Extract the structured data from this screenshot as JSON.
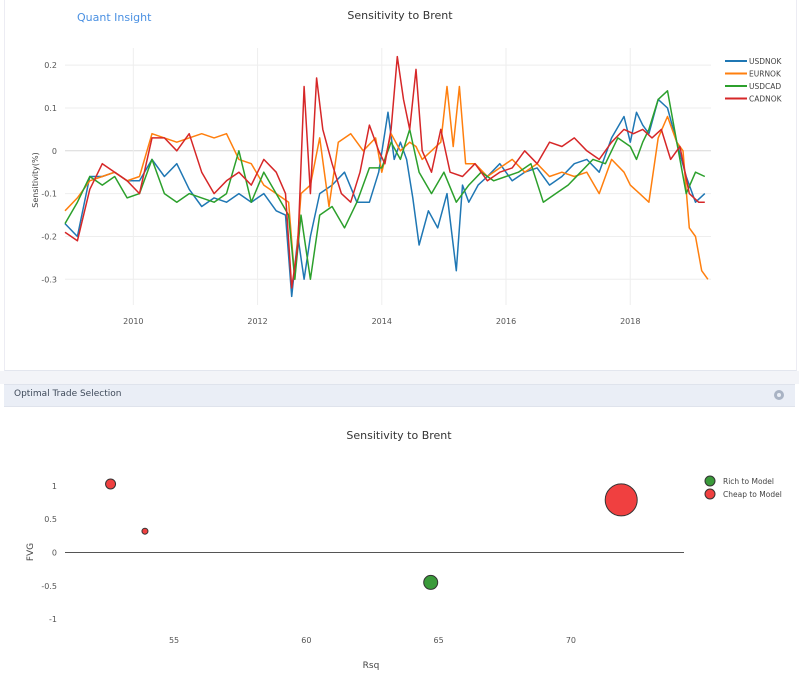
{
  "app": {
    "brand": "Quant Insight"
  },
  "panel": {
    "title": "Optimal Trade Selection"
  },
  "chart_data": [
    {
      "type": "line",
      "title": "Sensitivity to Brent",
      "xlabel": "",
      "ylabel": "Sensitivity(%)",
      "xlim": [
        2008.9,
        2019.3
      ],
      "ylim": [
        -0.36,
        0.24
      ],
      "xticks": [
        2010,
        2012,
        2014,
        2016,
        2018
      ],
      "yticks": [
        0.2,
        0.1,
        0,
        -0.1,
        -0.2,
        -0.3
      ],
      "ytick_labels": [
        "0.2",
        "0.1",
        "0",
        "-0.1",
        "-0.2",
        "-0.3"
      ],
      "grid": true,
      "legend_position": "top-right",
      "series": [
        {
          "name": "USDNOK",
          "color": "#1f77b4",
          "x": [
            2008.9,
            2009.1,
            2009.3,
            2009.5,
            2009.7,
            2009.9,
            2010.1,
            2010.3,
            2010.5,
            2010.7,
            2010.9,
            2011.1,
            2011.3,
            2011.5,
            2011.7,
            2011.9,
            2012.1,
            2012.3,
            2012.45,
            2012.55,
            2012.65,
            2012.75,
            2012.85,
            2013.0,
            2013.2,
            2013.4,
            2013.6,
            2013.8,
            2013.95,
            2014.1,
            2014.2,
            2014.3,
            2014.4,
            2014.5,
            2014.6,
            2014.75,
            2014.9,
            2015.05,
            2015.2,
            2015.3,
            2015.4,
            2015.55,
            2015.7,
            2015.9,
            2016.1,
            2016.3,
            2016.5,
            2016.7,
            2016.9,
            2017.1,
            2017.3,
            2017.5,
            2017.7,
            2017.9,
            2018.0,
            2018.1,
            2018.2,
            2018.3,
            2018.45,
            2018.6,
            2018.75,
            2018.9,
            2019.05,
            2019.2
          ],
          "y": [
            -0.17,
            -0.2,
            -0.06,
            -0.06,
            -0.05,
            -0.07,
            -0.07,
            -0.02,
            -0.06,
            -0.03,
            -0.09,
            -0.13,
            -0.11,
            -0.12,
            -0.1,
            -0.12,
            -0.1,
            -0.14,
            -0.15,
            -0.34,
            -0.2,
            -0.3,
            -0.2,
            -0.1,
            -0.08,
            -0.05,
            -0.12,
            -0.12,
            -0.05,
            0.09,
            -0.02,
            0.02,
            -0.02,
            -0.11,
            -0.22,
            -0.14,
            -0.18,
            -0.1,
            -0.28,
            -0.08,
            -0.12,
            -0.08,
            -0.06,
            -0.03,
            -0.07,
            -0.05,
            -0.04,
            -0.08,
            -0.06,
            -0.03,
            -0.02,
            -0.05,
            0.03,
            0.08,
            0.02,
            0.09,
            0.06,
            0.04,
            0.12,
            0.1,
            0.02,
            -0.06,
            -0.12,
            -0.1
          ]
        },
        {
          "name": "EURNOK",
          "color": "#ff7f0e",
          "x": [
            2008.9,
            2009.1,
            2009.3,
            2009.5,
            2009.7,
            2009.9,
            2010.1,
            2010.3,
            2010.5,
            2010.7,
            2010.9,
            2011.1,
            2011.3,
            2011.5,
            2011.7,
            2011.9,
            2012.1,
            2012.3,
            2012.5,
            2012.6,
            2012.7,
            2012.85,
            2013.0,
            2013.15,
            2013.3,
            2013.5,
            2013.7,
            2013.9,
            2014.0,
            2014.15,
            2014.3,
            2014.45,
            2014.55,
            2014.65,
            2014.8,
            2014.95,
            2015.05,
            2015.15,
            2015.25,
            2015.35,
            2015.5,
            2015.7,
            2015.9,
            2016.1,
            2016.3,
            2016.5,
            2016.7,
            2016.9,
            2017.1,
            2017.3,
            2017.5,
            2017.7,
            2017.9,
            2018.0,
            2018.15,
            2018.3,
            2018.45,
            2018.6,
            2018.75,
            2018.85,
            2018.95,
            2019.05,
            2019.15,
            2019.25
          ],
          "y": [
            -0.14,
            -0.11,
            -0.07,
            -0.06,
            -0.05,
            -0.07,
            -0.06,
            0.04,
            0.03,
            0.02,
            0.03,
            0.04,
            0.03,
            0.04,
            -0.02,
            -0.03,
            -0.08,
            -0.1,
            -0.12,
            -0.3,
            -0.1,
            -0.08,
            0.03,
            -0.13,
            0.02,
            0.04,
            0.0,
            0.03,
            -0.05,
            0.04,
            0.0,
            0.02,
            0.01,
            -0.02,
            0.0,
            0.02,
            0.15,
            0.01,
            0.15,
            -0.03,
            -0.03,
            -0.06,
            -0.04,
            -0.02,
            -0.05,
            -0.03,
            -0.06,
            -0.05,
            -0.06,
            -0.05,
            -0.1,
            -0.02,
            -0.05,
            -0.08,
            -0.1,
            -0.12,
            0.03,
            0.08,
            0.02,
            0.0,
            -0.18,
            -0.2,
            -0.28,
            -0.3
          ]
        },
        {
          "name": "USDCAD",
          "color": "#2ca02c",
          "x": [
            2008.9,
            2009.1,
            2009.3,
            2009.5,
            2009.7,
            2009.9,
            2010.1,
            2010.3,
            2010.5,
            2010.7,
            2010.9,
            2011.1,
            2011.3,
            2011.5,
            2011.7,
            2011.9,
            2012.1,
            2012.3,
            2012.5,
            2012.6,
            2012.7,
            2012.85,
            2013.0,
            2013.2,
            2013.4,
            2013.6,
            2013.8,
            2014.0,
            2014.15,
            2014.3,
            2014.45,
            2014.6,
            2014.8,
            2015.0,
            2015.2,
            2015.4,
            2015.6,
            2015.8,
            2016.0,
            2016.2,
            2016.4,
            2016.6,
            2016.8,
            2017.0,
            2017.2,
            2017.4,
            2017.6,
            2017.8,
            2018.0,
            2018.1,
            2018.2,
            2018.3,
            2018.45,
            2018.6,
            2018.75,
            2018.9,
            2019.05,
            2019.2
          ],
          "y": [
            -0.17,
            -0.12,
            -0.06,
            -0.08,
            -0.06,
            -0.11,
            -0.1,
            -0.02,
            -0.1,
            -0.12,
            -0.1,
            -0.11,
            -0.12,
            -0.1,
            0.0,
            -0.12,
            -0.05,
            -0.1,
            -0.15,
            -0.3,
            -0.15,
            -0.3,
            -0.15,
            -0.13,
            -0.18,
            -0.12,
            -0.04,
            -0.04,
            0.02,
            -0.02,
            0.05,
            -0.05,
            -0.1,
            -0.05,
            -0.12,
            -0.08,
            -0.05,
            -0.07,
            -0.06,
            -0.05,
            -0.03,
            -0.12,
            -0.1,
            -0.08,
            -0.05,
            -0.02,
            -0.03,
            0.03,
            0.01,
            -0.02,
            0.02,
            0.05,
            0.12,
            0.14,
            0.02,
            -0.1,
            -0.05,
            -0.06
          ]
        },
        {
          "name": "CADNOK",
          "color": "#d62728",
          "x": [
            2008.9,
            2009.1,
            2009.3,
            2009.5,
            2009.7,
            2009.9,
            2010.1,
            2010.3,
            2010.5,
            2010.7,
            2010.9,
            2011.1,
            2011.3,
            2011.5,
            2011.7,
            2011.9,
            2012.1,
            2012.3,
            2012.45,
            2012.55,
            2012.65,
            2012.75,
            2012.85,
            2012.95,
            2013.05,
            2013.2,
            2013.35,
            2013.5,
            2013.65,
            2013.8,
            2013.95,
            2014.05,
            2014.15,
            2014.25,
            2014.35,
            2014.45,
            2014.55,
            2014.65,
            2014.8,
            2014.95,
            2015.1,
            2015.3,
            2015.5,
            2015.7,
            2015.9,
            2016.1,
            2016.3,
            2016.5,
            2016.7,
            2016.9,
            2017.1,
            2017.3,
            2017.5,
            2017.7,
            2017.9,
            2018.05,
            2018.2,
            2018.35,
            2018.5,
            2018.65,
            2018.8,
            2018.95,
            2019.1,
            2019.2
          ],
          "y": [
            -0.19,
            -0.21,
            -0.09,
            -0.03,
            -0.05,
            -0.07,
            -0.1,
            0.03,
            0.03,
            0.0,
            0.04,
            -0.05,
            -0.1,
            -0.07,
            -0.05,
            -0.08,
            -0.02,
            -0.05,
            -0.1,
            -0.32,
            -0.22,
            0.15,
            -0.1,
            0.17,
            0.05,
            -0.03,
            -0.1,
            -0.12,
            -0.05,
            0.06,
            0.0,
            -0.03,
            0.05,
            0.22,
            0.12,
            0.05,
            0.19,
            0.0,
            -0.05,
            0.05,
            -0.05,
            -0.06,
            -0.03,
            -0.07,
            -0.05,
            -0.04,
            0.0,
            -0.03,
            0.02,
            0.01,
            0.03,
            0.0,
            -0.02,
            0.02,
            0.05,
            0.04,
            0.05,
            0.03,
            0.05,
            -0.02,
            0.01,
            -0.1,
            -0.12,
            -0.12
          ]
        }
      ]
    },
    {
      "type": "scatter",
      "title": "Sensitivity to Brent",
      "xlabel": "Rsq",
      "ylabel": "FVG",
      "xlim": [
        50.5,
        74.5
      ],
      "ylim": [
        -1.18,
        1.3
      ],
      "xticks": [
        55,
        60,
        65,
        70
      ],
      "yticks": [
        1,
        0.5,
        0,
        -0.5,
        -1
      ],
      "ytick_labels": [
        "1",
        "0.5",
        "0",
        "-0.5",
        "-1"
      ],
      "grid": false,
      "legend_position": "top-right",
      "series": [
        {
          "name": "Rich to Model",
          "color": "#3a9a3a",
          "points": [
            {
              "x": 64.7,
              "y": -0.45,
              "size": 7
            }
          ]
        },
        {
          "name": "Cheap to Model",
          "color": "#f04040",
          "points": [
            {
              "x": 52.6,
              "y": 1.03,
              "size": 5
            },
            {
              "x": 53.9,
              "y": 0.32,
              "size": 3
            },
            {
              "x": 71.9,
              "y": 0.79,
              "size": 16
            }
          ]
        }
      ]
    }
  ]
}
